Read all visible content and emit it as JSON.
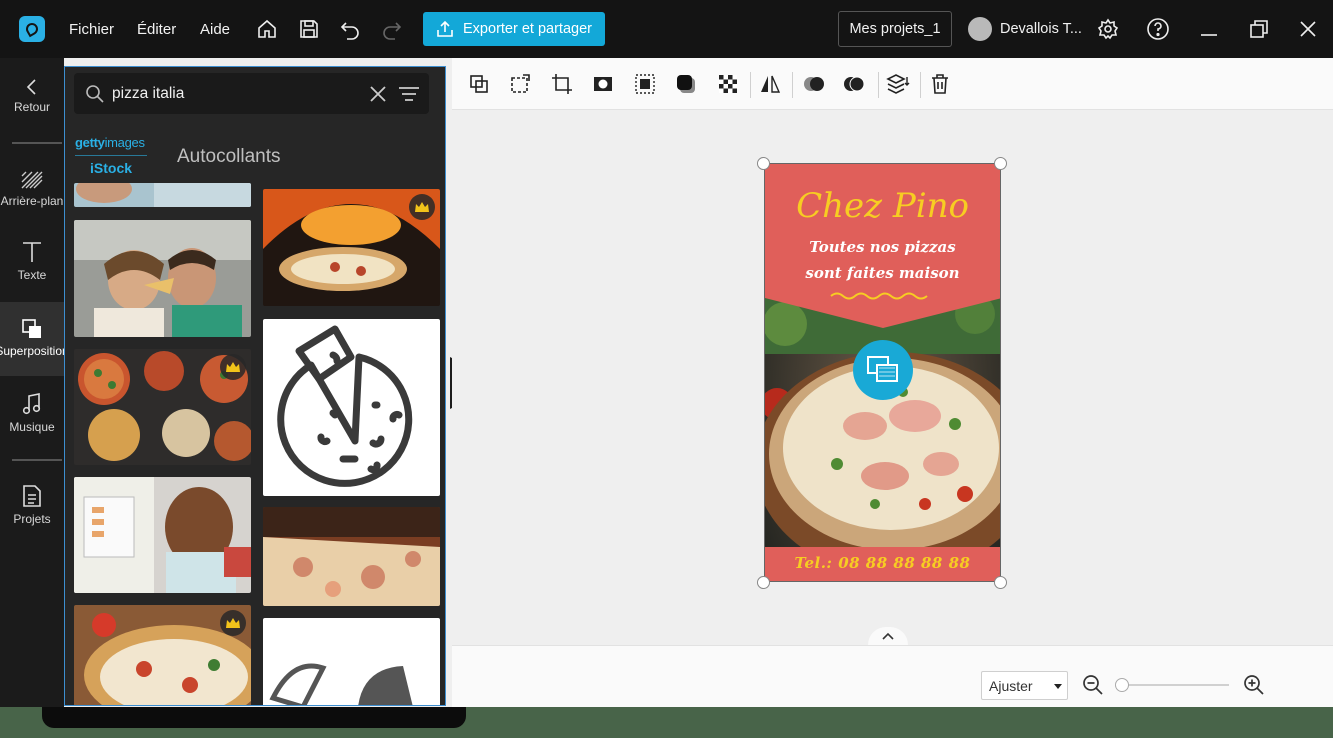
{
  "titlebar": {
    "menus": [
      "Fichier",
      "Éditer",
      "Aide"
    ],
    "export_label": "Exporter et partager",
    "project_label": "Mes projets_1",
    "user_name": "Devallois T..."
  },
  "nav": {
    "back": "Retour",
    "background": "Arrière-plan",
    "text": "Texte",
    "overlay": "Superposition",
    "music": "Musique",
    "projects": "Projets"
  },
  "panel": {
    "search_value": "pizza italia",
    "getty_a": "getty",
    "getty_b": "images",
    "istock": "iStock",
    "section_title": "Autocollants"
  },
  "poster": {
    "title": "Chez Pino",
    "subtitle_line1": "Toutes nos pizzas",
    "subtitle_line2": "sont faites maison",
    "phone": "Tel.: 08 88 88 88 88"
  },
  "bottom": {
    "zoom_mode": "Ajuster"
  },
  "colors": {
    "accent": "#13a8d8",
    "poster_band": "#e05f5a",
    "poster_text_yellow": "#f7cd22"
  }
}
